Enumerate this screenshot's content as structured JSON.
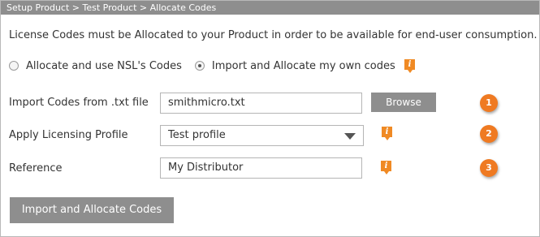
{
  "header": {
    "breadcrumb": "Setup Product > Test Product > Allocate Codes"
  },
  "intro_text": "License Codes must be Allocated to your Product in order to be available for end-user consumption.",
  "allocation_options": {
    "option_nsl": {
      "label": "Allocate and use NSL's Codes",
      "selected": false
    },
    "option_own": {
      "label": "Import and Allocate my own codes",
      "selected": true
    }
  },
  "form": {
    "import_codes": {
      "label": "Import Codes from .txt file",
      "value": "smithmicro.txt",
      "browse_label": "Browse",
      "step": "1"
    },
    "licensing_profile": {
      "label": "Apply Licensing Profile",
      "value": "Test profile",
      "step": "2"
    },
    "reference": {
      "label": "Reference",
      "value": "My Distributor",
      "step": "3"
    }
  },
  "actions": {
    "submit_label": "Import and Allocate Codes"
  },
  "icons": {
    "info": "info-icon"
  },
  "colors": {
    "header_bg": "#8e8e8e",
    "button_bg": "#8e8e8e",
    "accent_orange": "#f08a24",
    "text": "#333333",
    "border": "#b5b5b5"
  }
}
